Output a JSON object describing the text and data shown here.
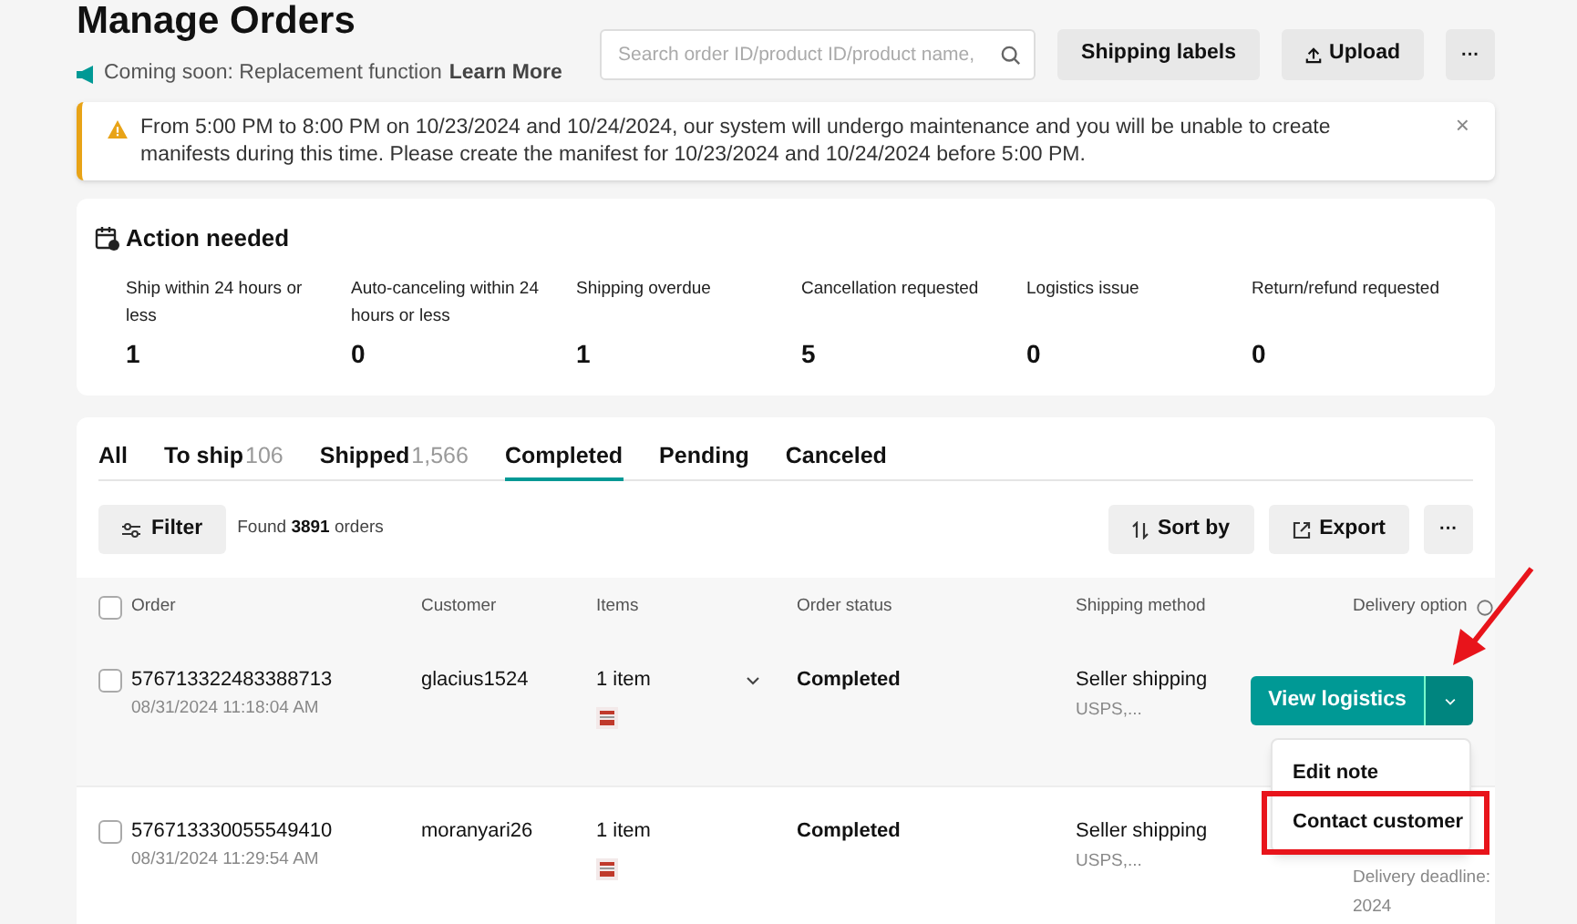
{
  "header": {
    "title": "Manage Orders",
    "notice": "Coming soon: Replacement function",
    "notice_link": "Learn More",
    "search": {
      "placeholder": "Search order ID/product ID/product name,"
    },
    "buttons": [
      {
        "kind": "plain",
        "label": "Shipping labels"
      },
      {
        "kind": "upload",
        "label": "Upload"
      },
      {
        "kind": "more",
        "label": "···"
      }
    ]
  },
  "banner": {
    "text": "From 5:00 PM to 8:00 PM on 10/23/2024 and 10/24/2024, our system will undergo maintenance and you will be unable to create manifests during this time. Please create the manifest for 10/23/2024 and 10/24/2024 before 5:00 PM.",
    "close": "×"
  },
  "action_needed": {
    "title": "Action needed",
    "items": [
      {
        "label": "Ship within 24 hours or less",
        "count": "1"
      },
      {
        "label": "Auto-canceling within 24 hours or less",
        "count": "0"
      },
      {
        "label": "Shipping overdue",
        "count": "1"
      },
      {
        "label": "Cancellation requested",
        "count": "5"
      },
      {
        "label": "Logistics issue",
        "count": "0"
      },
      {
        "label": "Return/refund requested",
        "count": "0"
      }
    ]
  },
  "tabs": [
    {
      "label": "All",
      "selected": false
    },
    {
      "label": "To ship",
      "count": "106",
      "selected": false
    },
    {
      "label": "Shipped",
      "count": "1,566",
      "selected": false
    },
    {
      "label": "Completed",
      "selected": true
    },
    {
      "label": "Pending",
      "selected": false
    },
    {
      "label": "Canceled",
      "selected": false
    }
  ],
  "toolbar": {
    "filter": "Filter",
    "found_prefix": "Found",
    "found_count": "3891",
    "found_suffix": "orders",
    "sort": "Sort by",
    "export": "Export",
    "more": "···"
  },
  "table": {
    "select_all_checked": false,
    "columns": [
      "Order",
      "Customer",
      "Items",
      "Order status",
      "Shipping method",
      "Delivery option"
    ],
    "rows": [
      {
        "order_id": "576713322483388713",
        "date": "08/31/2024 11:18:04 AM",
        "customer": "glacius1524",
        "items": "1 item",
        "expandable": true,
        "status": "Completed",
        "shipping": "Seller shipping",
        "carrier": "USPS,...",
        "checked": false,
        "hovered": true,
        "action": "View logistics"
      },
      {
        "order_id": "576713330055549410",
        "date": "08/31/2024 11:29:54 AM",
        "customer": "moranyari26",
        "items": "1 item",
        "expandable": false,
        "status": "Completed",
        "shipping": "Seller shipping",
        "carrier": "USPS,...",
        "checked": false,
        "hovered": false,
        "delivery_note": "Delivery deadline:",
        "delivery_year": "2024"
      }
    ]
  },
  "menu": {
    "items": [
      {
        "label": "Edit note",
        "highlighted": false
      },
      {
        "label": "Contact customer",
        "highlighted": true
      }
    ]
  }
}
